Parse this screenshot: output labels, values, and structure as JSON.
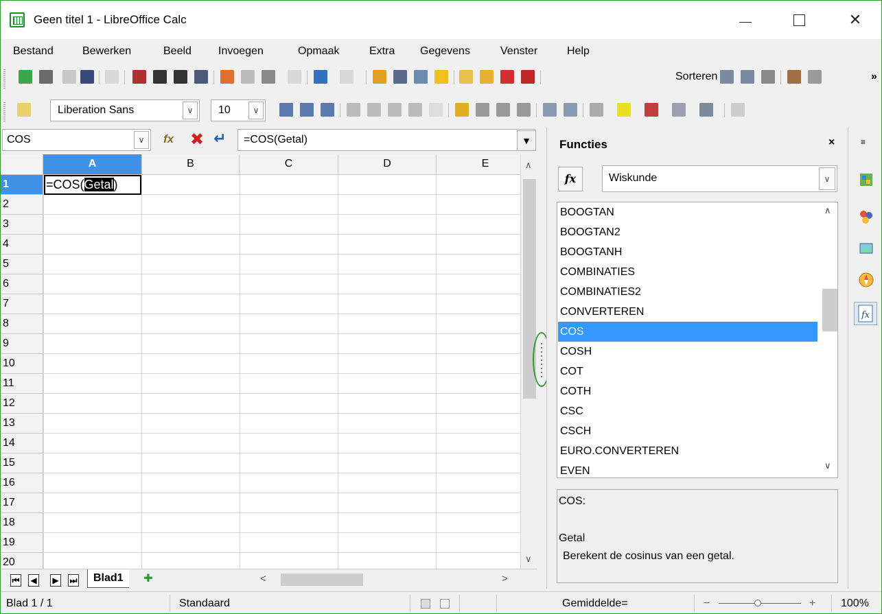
{
  "window": {
    "title": "Geen titel 1 - LibreOffice Calc",
    "minimize_glyph": "—",
    "close_glyph": "✕"
  },
  "menu": [
    {
      "label": "Bestand",
      "access": "B"
    },
    {
      "label": "Bewerken",
      "access": "w"
    },
    {
      "label": "Beeld",
      "access": "d"
    },
    {
      "label": "Invoegen",
      "access": "I"
    },
    {
      "label": "Opmaak",
      "access": "O"
    },
    {
      "label": "Extra",
      "access": "x"
    },
    {
      "label": "Gegevens",
      "access": "G"
    },
    {
      "label": "Venster",
      "access": "V"
    },
    {
      "label": "Help",
      "access": "H"
    }
  ],
  "toolbar": {
    "sort_label": "Sorteren",
    "more_glyph": "»",
    "font_name": "Liberation Sans",
    "font_size": "10"
  },
  "formula_bar": {
    "name_box": "COS",
    "fx_glyph": "fx",
    "cancel_glyph": "✖",
    "accept_glyph": "↵",
    "formula": "=COS(Getal)",
    "expand_glyph": "▼"
  },
  "grid": {
    "columns": [
      "A",
      "B",
      "C",
      "D",
      "E"
    ],
    "rows": [
      "1",
      "2",
      "3",
      "4",
      "5",
      "6",
      "7",
      "8",
      "9",
      "10",
      "11",
      "12",
      "13",
      "14",
      "15",
      "16",
      "17",
      "18",
      "19",
      "20"
    ],
    "active_cell": "A1",
    "a1_prefix": "=COS(",
    "a1_selected": "Getal",
    "a1_suffix": ")"
  },
  "sheets": {
    "tabs": [
      "Blad1"
    ],
    "add_glyph": "✚",
    "nav": [
      "⏮",
      "◀",
      "▶",
      "⏭"
    ]
  },
  "sidebar": {
    "title": "Functies",
    "close_glyph": "×",
    "fx_label": "fx",
    "category": "Wiskunde",
    "functions": [
      "BOOGTAN",
      "BOOGTAN2",
      "BOOGTANH",
      "COMBINATIES",
      "COMBINATIES2",
      "CONVERTEREN",
      "COS",
      "COSH",
      "COT",
      "COTH",
      "CSC",
      "CSCH",
      "EURO.CONVERTEREN",
      "EVEN"
    ],
    "selected_function": "COS",
    "description": {
      "function": "COS:",
      "argument": "Getal",
      "text": "Berekent de cosinus van een getal."
    }
  },
  "deck": {
    "menu_glyph": "≡",
    "icons": [
      "properties-icon",
      "styles-icon",
      "gallery-icon",
      "navigator-icon",
      "functions-icon"
    ],
    "active": "functions-icon"
  },
  "status": {
    "sheet": "Blad 1 / 1",
    "page_style": "Standaard",
    "aggregate": "Gemiddelde=",
    "zoom_minus": "−",
    "zoom_plus": "+",
    "zoom": "100%"
  },
  "colors": {
    "accent": "#3399ff",
    "header_active": "#3f92e6",
    "frame": "#2e9a2e",
    "cancel": "#d0201c",
    "accept": "#1c5db5"
  }
}
